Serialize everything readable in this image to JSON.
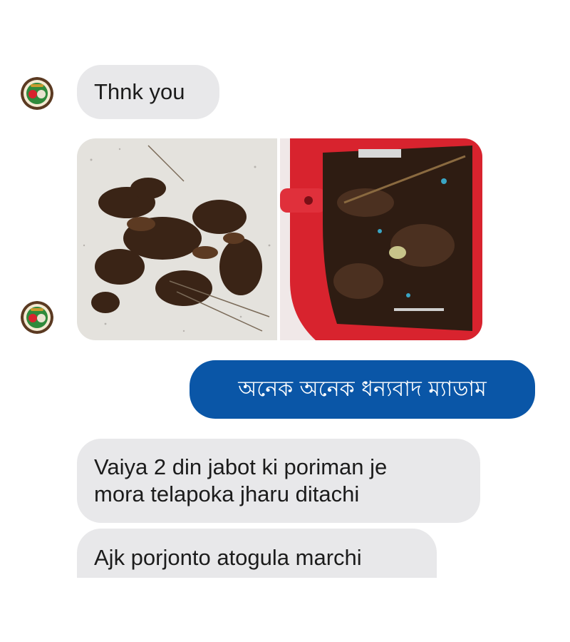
{
  "conversation": {
    "contact_avatar": "contact-profile-logo",
    "messages": [
      {
        "sender": "contact",
        "text": "Thnk you"
      },
      {
        "sender": "contact",
        "photos": [
          {
            "icon": "photo-dead-cockroaches-on-floor"
          },
          {
            "icon": "photo-dead-cockroaches-in-red-dustpan"
          }
        ]
      },
      {
        "sender": "me",
        "text": "অনেক অনেক ধন্যবাদ ম্যাডাম"
      },
      {
        "sender": "contact",
        "text": "Vaiya 2 din jabot ki poriman je\nmora telapoka jharu ditachi"
      },
      {
        "sender": "contact",
        "text": "Ajk porjonto atogula marchi"
      }
    ]
  },
  "colors": {
    "incoming_bubble": "#e8e8ea",
    "outgoing_bubble": "#0a56a7",
    "incoming_text": "#1c1c1c",
    "outgoing_text": "#ffffff",
    "dustpan_red": "#d8232e"
  }
}
